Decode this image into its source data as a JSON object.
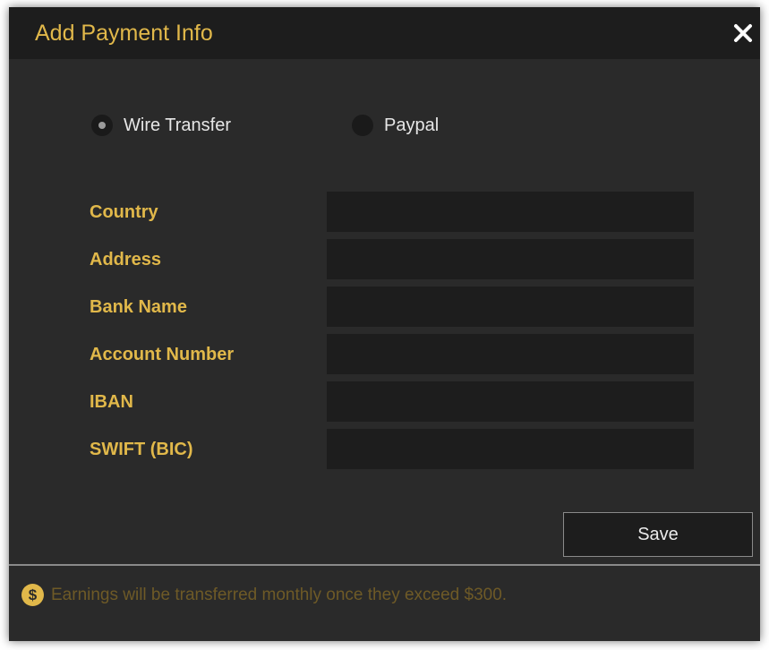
{
  "dialog": {
    "title": "Add Payment Info",
    "close_icon": "close-icon"
  },
  "payment_method": {
    "options": [
      {
        "label": "Wire Transfer",
        "checked": true
      },
      {
        "label": "Paypal",
        "checked": false
      }
    ]
  },
  "form": {
    "fields": [
      {
        "label": "Country",
        "value": ""
      },
      {
        "label": "Address",
        "value": ""
      },
      {
        "label": "Bank Name",
        "value": ""
      },
      {
        "label": "Account Number",
        "value": ""
      },
      {
        "label": "IBAN",
        "value": ""
      },
      {
        "label": "SWIFT (BIC)",
        "value": ""
      }
    ],
    "save_label": "Save"
  },
  "footer": {
    "icon": "dollar-icon",
    "icon_glyph": "$",
    "text": "Earnings will be transferred monthly once they exceed $300."
  },
  "colors": {
    "accent": "#e1b84a",
    "background": "#2a2a2a",
    "input_background": "#1d1d1d"
  }
}
